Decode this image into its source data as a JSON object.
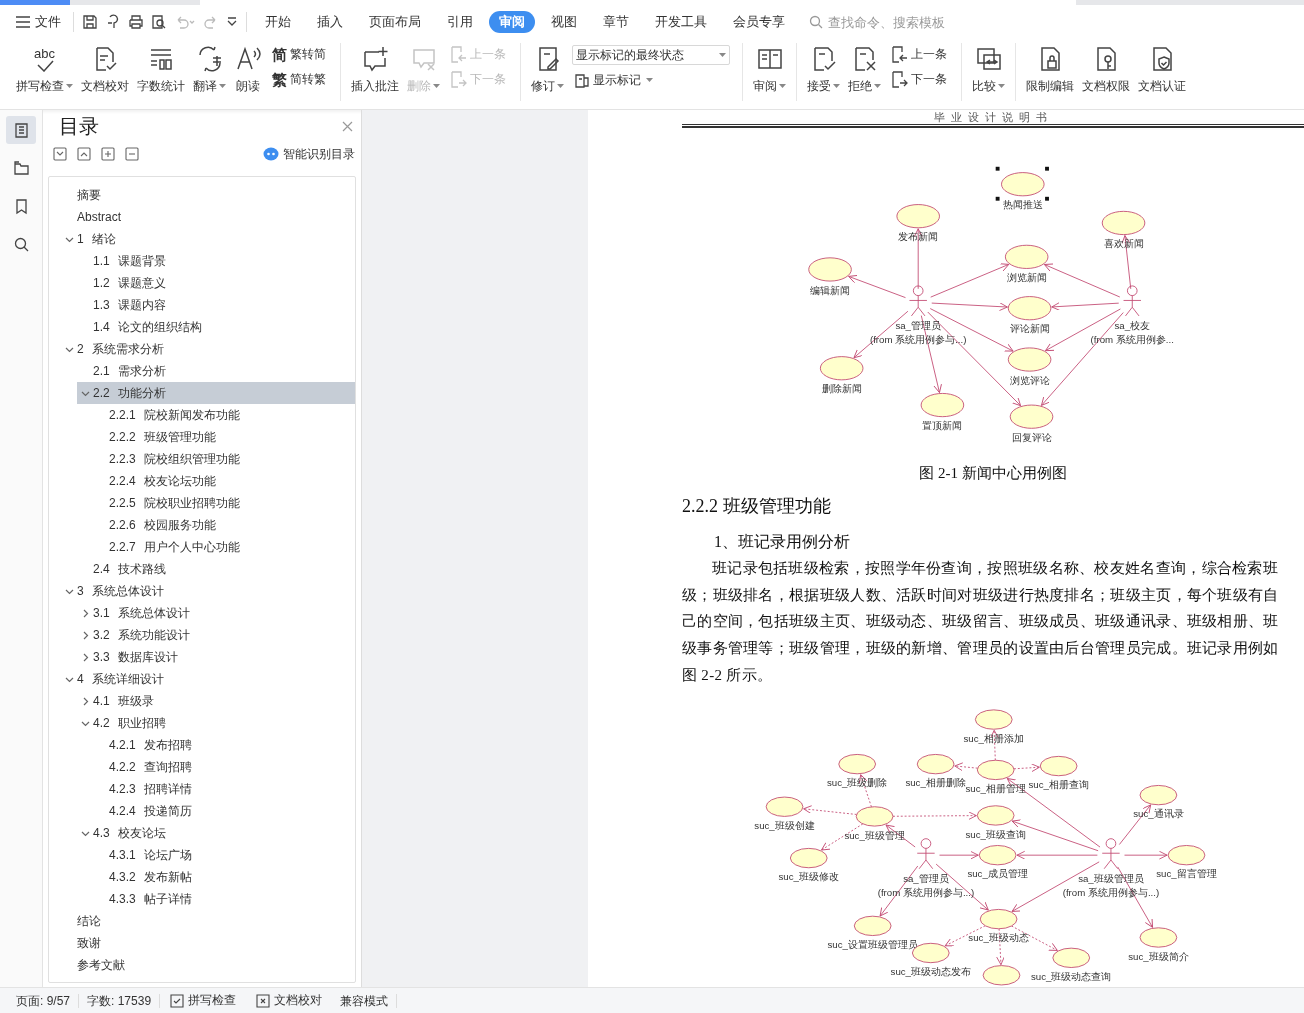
{
  "menu": {
    "file": "文件",
    "tabs": [
      {
        "label": "开始",
        "selected": false
      },
      {
        "label": "插入",
        "selected": false
      },
      {
        "label": "页面布局",
        "selected": false
      },
      {
        "label": "引用",
        "selected": false
      },
      {
        "label": "审阅",
        "selected": true
      },
      {
        "label": "视图",
        "selected": false
      },
      {
        "label": "章节",
        "selected": false
      },
      {
        "label": "开发工具",
        "selected": false
      },
      {
        "label": "会员专享",
        "selected": false
      }
    ],
    "search": {
      "placeholder": "查找命令、搜索模板"
    }
  },
  "ribbon": [
    [
      {
        "kind": "big",
        "label": "拼写检查",
        "dropdown": true,
        "disabled": false,
        "icon_text": "abc"
      },
      {
        "kind": "big",
        "label": "文档校对",
        "dropdown": false,
        "disabled": false
      },
      {
        "kind": "big",
        "label": "字数统计",
        "dropdown": false,
        "disabled": false
      },
      {
        "kind": "big",
        "label": "翻译",
        "dropdown": true,
        "disabled": false
      },
      {
        "kind": "big",
        "label": "朗读",
        "dropdown": false,
        "disabled": false
      },
      {
        "kind": "stack",
        "items": [
          {
            "label": "繁转简",
            "icon_text": "简",
            "disabled": false
          },
          {
            "label": "简转繁",
            "icon_text": "繁",
            "disabled": false
          }
        ]
      }
    ],
    [
      {
        "kind": "big",
        "label": "插入批注",
        "dropdown": false,
        "disabled": false
      },
      {
        "kind": "big",
        "label": "删除",
        "dropdown": true,
        "disabled": true
      },
      {
        "kind": "stack",
        "items": [
          {
            "label": "上一条",
            "disabled": true
          },
          {
            "label": "下一条",
            "disabled": true
          }
        ]
      }
    ],
    [
      {
        "kind": "big",
        "label": "修订",
        "dropdown": true,
        "disabled": false
      },
      {
        "kind": "select_stack",
        "select": {
          "value": "显示标记的最终状态"
        },
        "button": {
          "label": "显示标记",
          "dropdown": true
        }
      }
    ],
    [
      {
        "kind": "big",
        "label": "审阅",
        "dropdown": true,
        "disabled": false
      }
    ],
    [
      {
        "kind": "big",
        "label": "接受",
        "dropdown": true,
        "disabled": false
      },
      {
        "kind": "big",
        "label": "拒绝",
        "dropdown": true,
        "disabled": false
      },
      {
        "kind": "stack",
        "items": [
          {
            "label": "上一条",
            "disabled": false
          },
          {
            "label": "下一条",
            "disabled": false
          }
        ]
      }
    ],
    [
      {
        "kind": "big",
        "label": "比较",
        "dropdown": true,
        "disabled": false
      }
    ],
    [
      {
        "kind": "big",
        "label": "限制编辑",
        "dropdown": false,
        "disabled": false
      },
      {
        "kind": "big",
        "label": "文档权限",
        "dropdown": false,
        "disabled": false
      },
      {
        "kind": "big",
        "label": "文档认证",
        "dropdown": false,
        "disabled": false
      }
    ]
  ],
  "side_icons": [
    {
      "selected": true
    },
    {
      "selected": false
    },
    {
      "selected": false
    },
    {
      "selected": false
    }
  ],
  "toc": {
    "title": "目录",
    "smart_button": "智能识别目录",
    "items": [
      {
        "title": "摘要",
        "selected": false
      },
      {
        "title": "Abstract",
        "selected": false
      },
      {
        "number": "1",
        "title": "绪论",
        "selected": false,
        "expanded": true,
        "children": [
          {
            "number": "1.1",
            "title": "课题背景",
            "selected": false
          },
          {
            "number": "1.2",
            "title": "课题意义",
            "selected": false
          },
          {
            "number": "1.3",
            "title": "课题内容",
            "selected": false
          },
          {
            "number": "1.4",
            "title": "论文的组织结构",
            "selected": false
          }
        ]
      },
      {
        "number": "2",
        "title": "系统需求分析",
        "selected": false,
        "expanded": true,
        "children": [
          {
            "number": "2.1",
            "title": "需求分析",
            "selected": false
          },
          {
            "number": "2.2",
            "title": "功能分析",
            "selected": true,
            "expanded": true,
            "children": [
              {
                "number": "2.2.1",
                "title": "院校新闻发布功能",
                "selected": false
              },
              {
                "number": "2.2.2",
                "title": "班级管理功能",
                "selected": false
              },
              {
                "number": "2.2.3",
                "title": "院校组织管理功能",
                "selected": false
              },
              {
                "number": "2.2.4",
                "title": "校友论坛功能",
                "selected": false
              },
              {
                "number": "2.2.5",
                "title": "院校职业招聘功能",
                "selected": false
              },
              {
                "number": "2.2.6",
                "title": "校园服务功能",
                "selected": false
              },
              {
                "number": "2.2.7",
                "title": "用户个人中心功能",
                "selected": false
              }
            ]
          },
          {
            "number": "2.4",
            "title": "技术路线",
            "selected": false
          }
        ]
      },
      {
        "number": "3",
        "title": "系统总体设计",
        "selected": false,
        "expanded": true,
        "children": [
          {
            "number": "3.1",
            "title": "系统总体设计",
            "selected": false,
            "expanded": false
          },
          {
            "number": "3.2",
            "title": "系统功能设计",
            "selected": false,
            "expanded": false
          },
          {
            "number": "3.3",
            "title": "数据库设计",
            "selected": false,
            "expanded": false
          }
        ]
      },
      {
        "number": "4",
        "title": "系统详细设计",
        "selected": false,
        "expanded": true,
        "children": [
          {
            "number": "4.1",
            "title": "班级录",
            "selected": false,
            "expanded": false
          },
          {
            "number": "4.2",
            "title": "职业招聘",
            "selected": false,
            "expanded": true,
            "children": [
              {
                "number": "4.2.1",
                "title": "发布招聘",
                "selected": false
              },
              {
                "number": "4.2.2",
                "title": "查询招聘",
                "selected": false
              },
              {
                "number": "4.2.3",
                "title": "招聘详情",
                "selected": false
              },
              {
                "number": "4.2.4",
                "title": "投递简历",
                "selected": false
              }
            ]
          },
          {
            "number": "4.3",
            "title": "校友论坛",
            "selected": false,
            "expanded": true,
            "children": [
              {
                "number": "4.3.1",
                "title": "论坛广场",
                "selected": false
              },
              {
                "number": "4.3.2",
                "title": "发布新帖",
                "selected": false
              },
              {
                "number": "4.3.3",
                "title": "帖子详情",
                "selected": false
              }
            ]
          }
        ]
      },
      {
        "title": "结论",
        "selected": false
      },
      {
        "title": "致谢",
        "selected": false
      },
      {
        "title": "参考文献",
        "selected": false
      }
    ]
  },
  "document": {
    "header": "毕业设计说明书",
    "figure_1": {
      "nodes": [
        {
          "kind": "use_case",
          "label": "热闻推送",
          "selected": true
        },
        {
          "kind": "use_case",
          "label": "发布新闻",
          "selected": false
        },
        {
          "kind": "use_case",
          "label": "喜欢新闻",
          "selected": false
        },
        {
          "kind": "use_case",
          "label": "浏览新闻",
          "selected": false
        },
        {
          "kind": "use_case",
          "label": "编辑新闻",
          "selected": false
        },
        {
          "kind": "use_case",
          "label": "评论新闻",
          "selected": false
        },
        {
          "kind": "use_case",
          "label": "浏览评论",
          "selected": false
        },
        {
          "kind": "use_case",
          "label": "删除新闻",
          "selected": false
        },
        {
          "kind": "use_case",
          "label": "置顶新闻",
          "selected": false
        },
        {
          "kind": "use_case",
          "label": "回复评论",
          "selected": false
        }
      ],
      "actors": [
        {
          "name": "sa_管理员",
          "from": "(from 系统用例参与...)"
        },
        {
          "name": "sa_校友",
          "from": "(from 系统用例参..."
        }
      ]
    },
    "caption_1": "图 2-1  新闻中心用例图",
    "heading": "2.2.2  班级管理功能",
    "subheading": "1、班记录用例分析",
    "body_lines": [
      "班记录包括班级检索，按照学年份查询，按照班级名称、校友姓名查询，综合检索班",
      "级；班级排名，根据班级人数、活跃时间对班级进行热度排名；班级主页，每个班级有自",
      "己的空间，包括班级主页、班级动态、班级留言、班级成员、班级通讯录、班级相册、班",
      "级事务管理等；班级管理，班级的新增、管理员的设置由后台管理员完成。班记录用例如",
      "图 2-2 所示。"
    ],
    "figure_2": {
      "nodes": [
        {
          "kind": "use_case",
          "label": "suc_相册添加"
        },
        {
          "kind": "use_case",
          "label": "suc_班级删除"
        },
        {
          "kind": "use_case",
          "label": "suc_相册删除"
        },
        {
          "kind": "use_case",
          "label": "suc_相册管理"
        },
        {
          "kind": "use_case",
          "label": "suc_相册查询"
        },
        {
          "kind": "use_case",
          "label": "suc_通讯录"
        },
        {
          "kind": "use_case",
          "label": "suc_班级创建"
        },
        {
          "kind": "use_case",
          "label": "suc_班级管理"
        },
        {
          "kind": "use_case",
          "label": "suc_班级查询"
        },
        {
          "kind": "use_case",
          "label": "suc_班级修改"
        },
        {
          "kind": "use_case",
          "label": "suc_成员管理"
        },
        {
          "kind": "use_case",
          "label": "suc_留言管理"
        },
        {
          "kind": "use_case",
          "label": "suc_设置班级管理员"
        },
        {
          "kind": "use_case",
          "label": "suc_班级动态"
        },
        {
          "kind": "use_case",
          "label": "suc_班级动态发布"
        },
        {
          "kind": "use_case"
        },
        {
          "kind": "use_case",
          "label": "suc_班级动态查询"
        },
        {
          "kind": "use_case",
          "label": "suc_班级简介"
        }
      ],
      "actors": [
        {
          "name": "sa_管理员",
          "from": "(from 系统用例参与...)"
        },
        {
          "name": "sa_班级管理员",
          "from": "(from 系统用例参与...)"
        }
      ]
    }
  },
  "status_bar": {
    "page": "页面: 9/57",
    "words": "字数: 17539",
    "spell": "拼写检查",
    "proof": "文档校对",
    "mode": "兼容模式"
  }
}
